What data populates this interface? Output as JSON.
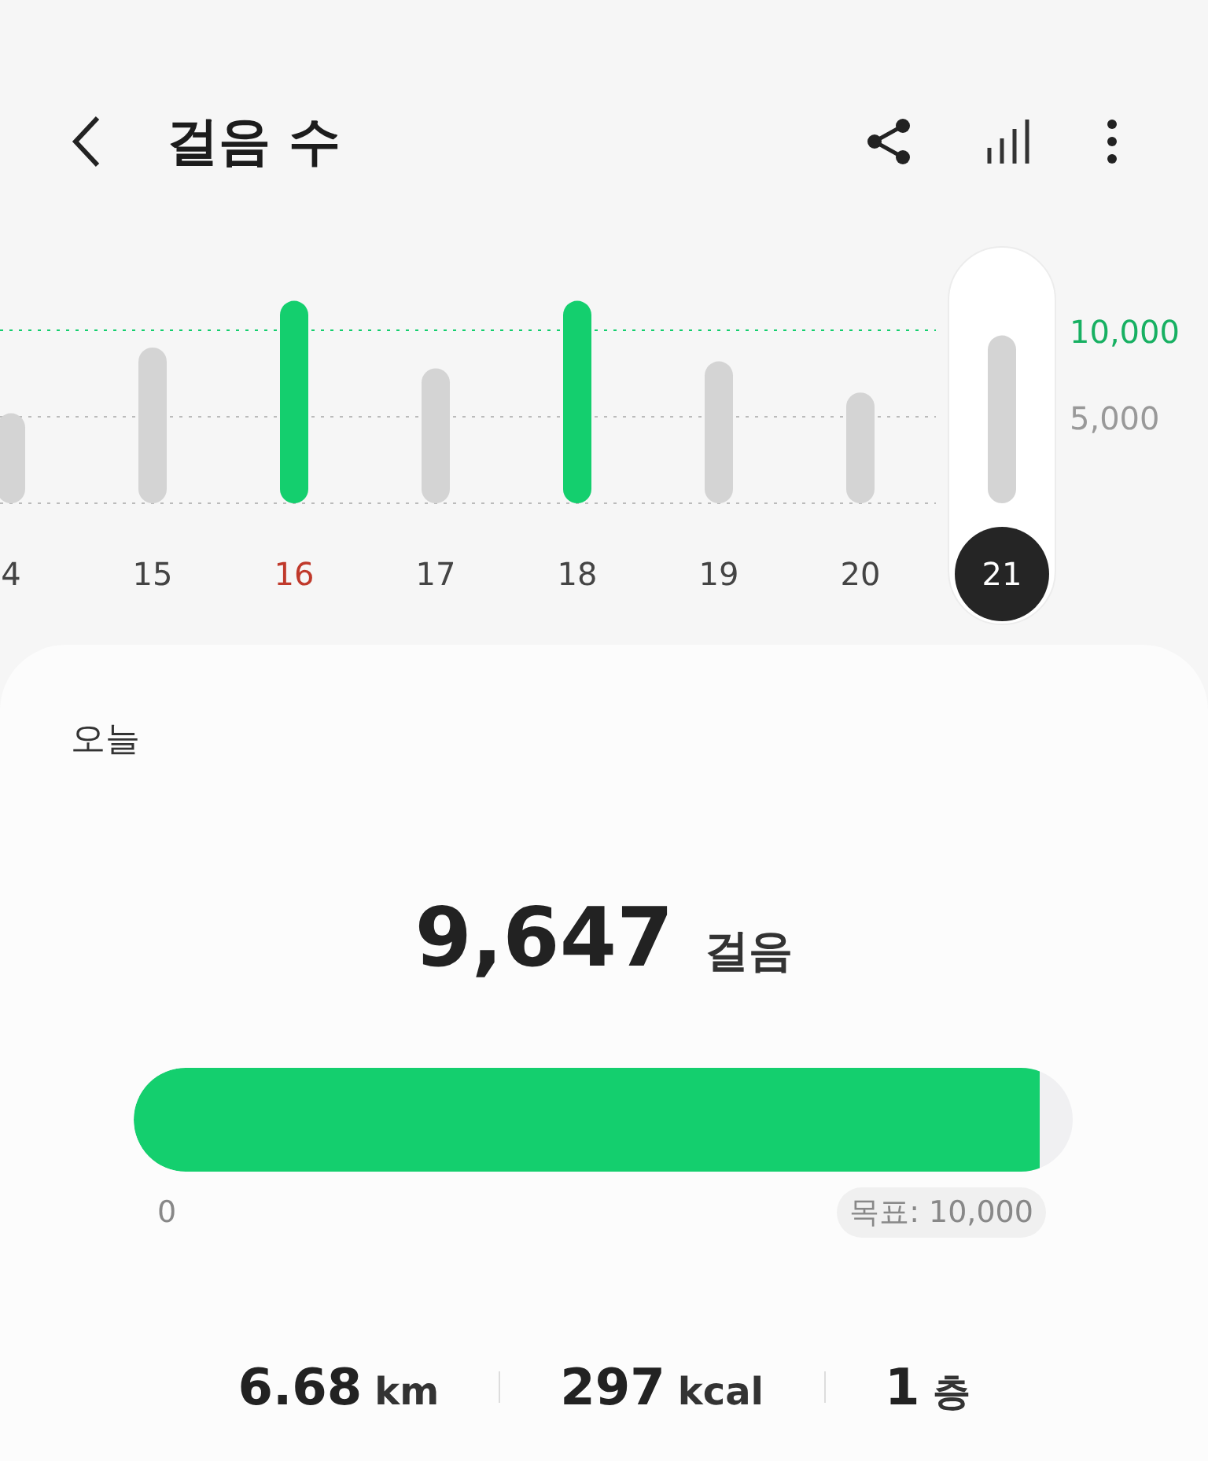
{
  "header": {
    "title": "걸음 수"
  },
  "chart": {
    "chart_data": {
      "type": "bar",
      "categories": [
        "4",
        "15",
        "16",
        "17",
        "18",
        "19",
        "20",
        "21"
      ],
      "series": [
        {
          "color": "#d4d4d4",
          "values": [
            5200,
            9000,
            null,
            7800,
            null,
            8200,
            6400,
            9700
          ]
        },
        {
          "color": "#14cf6e",
          "values": [
            null,
            null,
            11700,
            null,
            11700,
            null,
            null,
            null
          ]
        }
      ],
      "ylim": [
        0,
        12000
      ],
      "yticks": [
        {
          "value": 5000,
          "label": "5,000"
        },
        {
          "value": 10000,
          "label": "10,000"
        }
      ]
    },
    "days": [
      {
        "kind": "normal"
      },
      {
        "kind": "normal"
      },
      {
        "kind": "holiday"
      },
      {
        "kind": "normal"
      },
      {
        "kind": "normal"
      },
      {
        "kind": "normal"
      },
      {
        "kind": "normal"
      },
      {
        "kind": "selected"
      }
    ]
  },
  "card": {
    "period": "오늘",
    "steps": "9,647",
    "steps_unit": "걸음",
    "progress": {
      "level": 0.9647,
      "min": "0",
      "goal": "목표: 10,000"
    },
    "stats": [
      {
        "value": "6.68",
        "unit": "km"
      },
      {
        "value": "297",
        "unit": "kcal"
      },
      {
        "value": "1",
        "unit": "층"
      }
    ]
  }
}
